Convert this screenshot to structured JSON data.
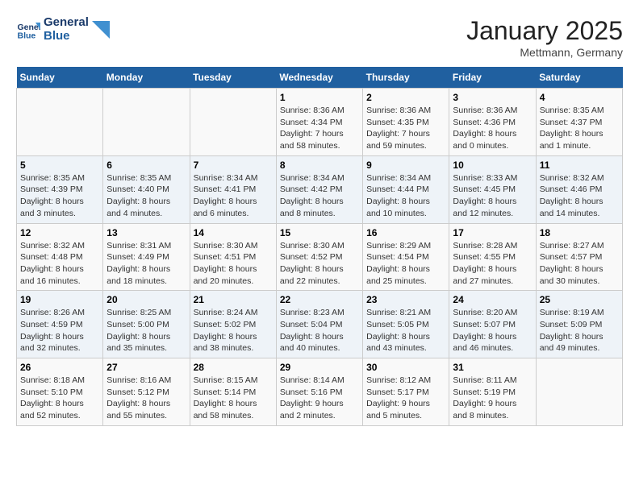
{
  "header": {
    "logo_line1": "General",
    "logo_line2": "Blue",
    "month_title": "January 2025",
    "location": "Mettmann, Germany"
  },
  "weekdays": [
    "Sunday",
    "Monday",
    "Tuesday",
    "Wednesday",
    "Thursday",
    "Friday",
    "Saturday"
  ],
  "weeks": [
    [
      {
        "day": "",
        "info": ""
      },
      {
        "day": "",
        "info": ""
      },
      {
        "day": "",
        "info": ""
      },
      {
        "day": "1",
        "info": "Sunrise: 8:36 AM\nSunset: 4:34 PM\nDaylight: 7 hours and 58 minutes."
      },
      {
        "day": "2",
        "info": "Sunrise: 8:36 AM\nSunset: 4:35 PM\nDaylight: 7 hours and 59 minutes."
      },
      {
        "day": "3",
        "info": "Sunrise: 8:36 AM\nSunset: 4:36 PM\nDaylight: 8 hours and 0 minutes."
      },
      {
        "day": "4",
        "info": "Sunrise: 8:35 AM\nSunset: 4:37 PM\nDaylight: 8 hours and 1 minute."
      }
    ],
    [
      {
        "day": "5",
        "info": "Sunrise: 8:35 AM\nSunset: 4:39 PM\nDaylight: 8 hours and 3 minutes."
      },
      {
        "day": "6",
        "info": "Sunrise: 8:35 AM\nSunset: 4:40 PM\nDaylight: 8 hours and 4 minutes."
      },
      {
        "day": "7",
        "info": "Sunrise: 8:34 AM\nSunset: 4:41 PM\nDaylight: 8 hours and 6 minutes."
      },
      {
        "day": "8",
        "info": "Sunrise: 8:34 AM\nSunset: 4:42 PM\nDaylight: 8 hours and 8 minutes."
      },
      {
        "day": "9",
        "info": "Sunrise: 8:34 AM\nSunset: 4:44 PM\nDaylight: 8 hours and 10 minutes."
      },
      {
        "day": "10",
        "info": "Sunrise: 8:33 AM\nSunset: 4:45 PM\nDaylight: 8 hours and 12 minutes."
      },
      {
        "day": "11",
        "info": "Sunrise: 8:32 AM\nSunset: 4:46 PM\nDaylight: 8 hours and 14 minutes."
      }
    ],
    [
      {
        "day": "12",
        "info": "Sunrise: 8:32 AM\nSunset: 4:48 PM\nDaylight: 8 hours and 16 minutes."
      },
      {
        "day": "13",
        "info": "Sunrise: 8:31 AM\nSunset: 4:49 PM\nDaylight: 8 hours and 18 minutes."
      },
      {
        "day": "14",
        "info": "Sunrise: 8:30 AM\nSunset: 4:51 PM\nDaylight: 8 hours and 20 minutes."
      },
      {
        "day": "15",
        "info": "Sunrise: 8:30 AM\nSunset: 4:52 PM\nDaylight: 8 hours and 22 minutes."
      },
      {
        "day": "16",
        "info": "Sunrise: 8:29 AM\nSunset: 4:54 PM\nDaylight: 8 hours and 25 minutes."
      },
      {
        "day": "17",
        "info": "Sunrise: 8:28 AM\nSunset: 4:55 PM\nDaylight: 8 hours and 27 minutes."
      },
      {
        "day": "18",
        "info": "Sunrise: 8:27 AM\nSunset: 4:57 PM\nDaylight: 8 hours and 30 minutes."
      }
    ],
    [
      {
        "day": "19",
        "info": "Sunrise: 8:26 AM\nSunset: 4:59 PM\nDaylight: 8 hours and 32 minutes."
      },
      {
        "day": "20",
        "info": "Sunrise: 8:25 AM\nSunset: 5:00 PM\nDaylight: 8 hours and 35 minutes."
      },
      {
        "day": "21",
        "info": "Sunrise: 8:24 AM\nSunset: 5:02 PM\nDaylight: 8 hours and 38 minutes."
      },
      {
        "day": "22",
        "info": "Sunrise: 8:23 AM\nSunset: 5:04 PM\nDaylight: 8 hours and 40 minutes."
      },
      {
        "day": "23",
        "info": "Sunrise: 8:21 AM\nSunset: 5:05 PM\nDaylight: 8 hours and 43 minutes."
      },
      {
        "day": "24",
        "info": "Sunrise: 8:20 AM\nSunset: 5:07 PM\nDaylight: 8 hours and 46 minutes."
      },
      {
        "day": "25",
        "info": "Sunrise: 8:19 AM\nSunset: 5:09 PM\nDaylight: 8 hours and 49 minutes."
      }
    ],
    [
      {
        "day": "26",
        "info": "Sunrise: 8:18 AM\nSunset: 5:10 PM\nDaylight: 8 hours and 52 minutes."
      },
      {
        "day": "27",
        "info": "Sunrise: 8:16 AM\nSunset: 5:12 PM\nDaylight: 8 hours and 55 minutes."
      },
      {
        "day": "28",
        "info": "Sunrise: 8:15 AM\nSunset: 5:14 PM\nDaylight: 8 hours and 58 minutes."
      },
      {
        "day": "29",
        "info": "Sunrise: 8:14 AM\nSunset: 5:16 PM\nDaylight: 9 hours and 2 minutes."
      },
      {
        "day": "30",
        "info": "Sunrise: 8:12 AM\nSunset: 5:17 PM\nDaylight: 9 hours and 5 minutes."
      },
      {
        "day": "31",
        "info": "Sunrise: 8:11 AM\nSunset: 5:19 PM\nDaylight: 9 hours and 8 minutes."
      },
      {
        "day": "",
        "info": ""
      }
    ]
  ]
}
